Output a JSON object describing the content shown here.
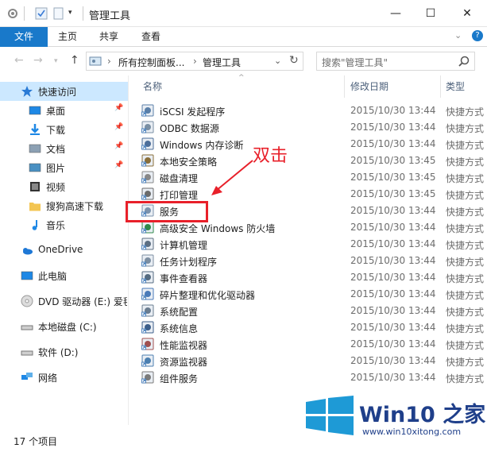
{
  "window": {
    "title": "管理工具",
    "minimize": "—",
    "maximize": "☐",
    "close": "✕"
  },
  "ribbon": {
    "tabs": [
      "文件",
      "主页",
      "共享",
      "查看"
    ],
    "expand": "⌄",
    "help": "?"
  },
  "address": {
    "segments": [
      "所有控制面板...",
      "管理工具"
    ],
    "separator": "›",
    "refresh": "↻",
    "dropdown": "⌄"
  },
  "search": {
    "placeholder": "搜索\"管理工具\""
  },
  "nav": {
    "items": [
      {
        "label": "快速访问",
        "icon": "star-icon",
        "pinned": false,
        "selected": true
      },
      {
        "label": "桌面",
        "icon": "desktop-icon",
        "pinned": true
      },
      {
        "label": "下载",
        "icon": "download-icon",
        "pinned": true
      },
      {
        "label": "文档",
        "icon": "document-icon",
        "pinned": true
      },
      {
        "label": "图片",
        "icon": "picture-icon",
        "pinned": true
      },
      {
        "label": "视频",
        "icon": "video-icon",
        "pinned": false
      },
      {
        "label": "搜狗高速下载",
        "icon": "folder-icon",
        "pinned": false
      },
      {
        "label": "音乐",
        "icon": "music-icon",
        "pinned": false
      },
      {
        "label": "OneDrive",
        "icon": "cloud-icon",
        "pinned": false
      },
      {
        "label": "此电脑",
        "icon": "computer-icon",
        "pinned": false
      },
      {
        "label": "DVD 驱动器 (E:) 爱毬",
        "icon": "dvd-icon",
        "pinned": false
      },
      {
        "label": "本地磁盘 (C:)",
        "icon": "disk-icon",
        "pinned": false
      },
      {
        "label": "软件 (D:)",
        "icon": "disk-icon",
        "pinned": false
      },
      {
        "label": "网络",
        "icon": "network-icon",
        "pinned": false
      }
    ]
  },
  "columns": {
    "name": "名称",
    "date": "修改日期",
    "type": "类型"
  },
  "files": [
    {
      "name": "iSCSI 发起程序",
      "date": "2015/10/30 13:44",
      "type": "快捷方式"
    },
    {
      "name": "ODBC 数据源",
      "date": "2015/10/30 13:44",
      "type": "快捷方式"
    },
    {
      "name": "Windows 内存诊断",
      "date": "2015/10/30 13:44",
      "type": "快捷方式"
    },
    {
      "name": "本地安全策略",
      "date": "2015/10/30 13:45",
      "type": "快捷方式"
    },
    {
      "name": "磁盘清理",
      "date": "2015/10/30 13:45",
      "type": "快捷方式"
    },
    {
      "name": "打印管理",
      "date": "2015/10/30 13:45",
      "type": "快捷方式"
    },
    {
      "name": "服务",
      "date": "2015/10/30 13:44",
      "type": "快捷方式"
    },
    {
      "name": "高级安全 Windows 防火墙",
      "date": "2015/10/30 13:44",
      "type": "快捷方式"
    },
    {
      "name": "计算机管理",
      "date": "2015/10/30 13:44",
      "type": "快捷方式"
    },
    {
      "name": "任务计划程序",
      "date": "2015/10/30 13:44",
      "type": "快捷方式"
    },
    {
      "name": "事件查看器",
      "date": "2015/10/30 13:44",
      "type": "快捷方式"
    },
    {
      "name": "碎片整理和优化驱动器",
      "date": "2015/10/30 13:44",
      "type": "快捷方式"
    },
    {
      "name": "系统配置",
      "date": "2015/10/30 13:44",
      "type": "快捷方式"
    },
    {
      "name": "系统信息",
      "date": "2015/10/30 13:44",
      "type": "快捷方式"
    },
    {
      "name": "性能监视器",
      "date": "2015/10/30 13:44",
      "type": "快捷方式"
    },
    {
      "name": "资源监视器",
      "date": "2015/10/30 13:44",
      "type": "快捷方式"
    },
    {
      "name": "组件服务",
      "date": "2015/10/30 13:44",
      "type": "快捷方式"
    }
  ],
  "annotation": {
    "text": "双击"
  },
  "status": {
    "count": "17 个项目"
  },
  "watermark": {
    "title": "Win10 之家",
    "url": "www.win10xitong.com"
  },
  "colors": {
    "accent": "#1979ca",
    "selection": "#cce8ff",
    "annotation": "#e8202a",
    "header_text": "#4c607a"
  }
}
